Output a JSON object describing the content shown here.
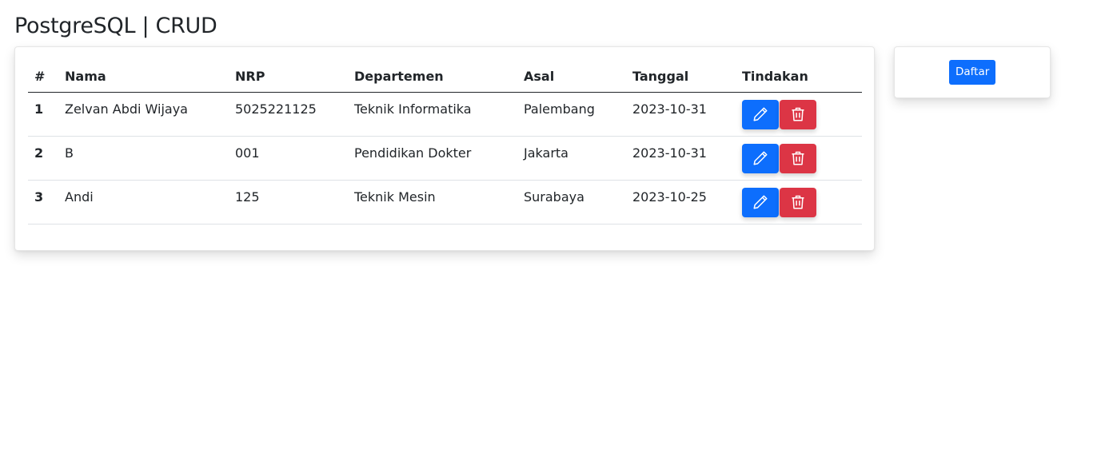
{
  "header": {
    "title": "PostgreSQL | CRUD"
  },
  "table": {
    "columns": [
      "#",
      "Nama",
      "NRP",
      "Departemen",
      "Asal",
      "Tanggal",
      "Tindakan"
    ],
    "rows": [
      {
        "no": "1",
        "nama": "Zelvan Abdi Wijaya",
        "nrp": "5025221125",
        "departemen": "Teknik Informatika",
        "asal": "Palembang",
        "tanggal": "2023-10-31"
      },
      {
        "no": "2",
        "nama": "B",
        "nrp": "001",
        "departemen": "Pendidikan Dokter",
        "asal": "Jakarta",
        "tanggal": "2023-10-31"
      },
      {
        "no": "3",
        "nama": "Andi",
        "nrp": "125",
        "departemen": "Teknik Mesin",
        "asal": "Surabaya",
        "tanggal": "2023-10-25"
      }
    ],
    "actions": {
      "edit_icon": "pencil-icon",
      "delete_icon": "trash-icon"
    }
  },
  "sidebar": {
    "register_label": "Daftar"
  },
  "colors": {
    "primary": "#0d6efd",
    "danger": "#dc3545",
    "text": "#212529"
  }
}
